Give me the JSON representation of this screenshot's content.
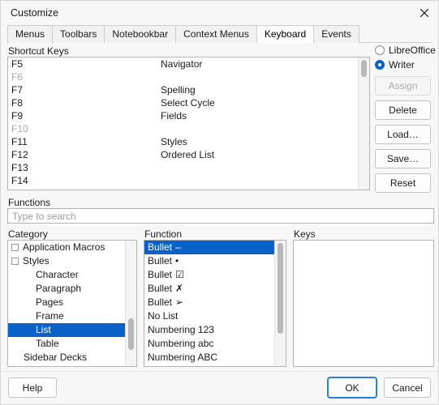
{
  "window": {
    "title": "Customize",
    "close_icon": "close-icon"
  },
  "tabs": [
    {
      "label": "Menus",
      "active": false
    },
    {
      "label": "Toolbars",
      "active": false
    },
    {
      "label": "Notebookbar",
      "active": false
    },
    {
      "label": "Context Menus",
      "active": false
    },
    {
      "label": "Keyboard",
      "active": true
    },
    {
      "label": "Events",
      "active": false
    }
  ],
  "shortcut_keys": {
    "label": "Shortcut Keys",
    "columns": [
      "Shortcut Keys",
      "Function"
    ],
    "rows": [
      {
        "key": "F5",
        "command": "Navigator",
        "disabled": false
      },
      {
        "key": "F6",
        "command": "",
        "disabled": true
      },
      {
        "key": "F7",
        "command": "Spelling",
        "disabled": false
      },
      {
        "key": "F8",
        "command": "Select Cycle",
        "disabled": false
      },
      {
        "key": "F9",
        "command": "Fields",
        "disabled": false
      },
      {
        "key": "F10",
        "command": "",
        "disabled": true
      },
      {
        "key": "F11",
        "command": "Styles",
        "disabled": false
      },
      {
        "key": "F12",
        "command": "Ordered List",
        "disabled": false
      },
      {
        "key": "F13",
        "command": "",
        "disabled": false
      },
      {
        "key": "F14",
        "command": "",
        "disabled": false
      }
    ],
    "scroll_thumb_top_pct": 2,
    "scroll_thumb_height_pct": 13
  },
  "scope": {
    "options": [
      {
        "label": "LibreOffice",
        "selected": false
      },
      {
        "label": "Writer",
        "selected": true
      }
    ]
  },
  "side_buttons": [
    {
      "label": "Assign",
      "enabled": false
    },
    {
      "label": "Delete",
      "enabled": true
    },
    {
      "label": "Load…",
      "enabled": true
    },
    {
      "label": "Save…",
      "enabled": true
    },
    {
      "label": "Reset",
      "enabled": true
    }
  ],
  "functions": {
    "label": "Functions",
    "search_placeholder": "Type to search",
    "search_value": ""
  },
  "category": {
    "label": "Category",
    "rows": [
      {
        "label": "Application Macros",
        "indent": 0,
        "expander": true,
        "selected": false
      },
      {
        "label": "Styles",
        "indent": 0,
        "expander": true,
        "selected": false
      },
      {
        "label": "Character",
        "indent": 2,
        "expander": false,
        "selected": false
      },
      {
        "label": "Paragraph",
        "indent": 2,
        "expander": false,
        "selected": false
      },
      {
        "label": "Pages",
        "indent": 2,
        "expander": false,
        "selected": false
      },
      {
        "label": "Frame",
        "indent": 2,
        "expander": false,
        "selected": false
      },
      {
        "label": "List",
        "indent": 2,
        "expander": false,
        "selected": true
      },
      {
        "label": "Table",
        "indent": 2,
        "expander": false,
        "selected": false
      },
      {
        "label": "Sidebar Decks",
        "indent": 1,
        "expander": false,
        "selected": false
      }
    ],
    "scroll_thumb_top_pct": 62,
    "scroll_thumb_height_pct": 25
  },
  "function": {
    "label": "Function",
    "rows": [
      {
        "label": "Bullet",
        "glyph": "–",
        "selected": true
      },
      {
        "label": "Bullet",
        "glyph": "•",
        "selected": false
      },
      {
        "label": "Bullet",
        "glyph": "☑",
        "selected": false
      },
      {
        "label": "Bullet",
        "glyph": "✗",
        "selected": false
      },
      {
        "label": "Bullet",
        "glyph": "➢",
        "selected": false
      },
      {
        "label": "No List",
        "glyph": "",
        "selected": false
      },
      {
        "label": "Numbering 123",
        "glyph": "",
        "selected": false
      },
      {
        "label": "Numbering abc",
        "glyph": "",
        "selected": false
      },
      {
        "label": "Numbering ABC",
        "glyph": "",
        "selected": false
      }
    ],
    "scroll_thumb_top_pct": 2,
    "scroll_thumb_height_pct": 72
  },
  "keys": {
    "label": "Keys",
    "rows": []
  },
  "footer": {
    "help_label": "Help",
    "ok_label": "OK",
    "cancel_label": "Cancel"
  },
  "colors": {
    "selection": "#0a62c8",
    "dialog_bg": "#f7f7f7",
    "list_bg": "#ffffff",
    "disabled_text": "#a8a8a8",
    "focus_ring": "#2a7fd4"
  }
}
